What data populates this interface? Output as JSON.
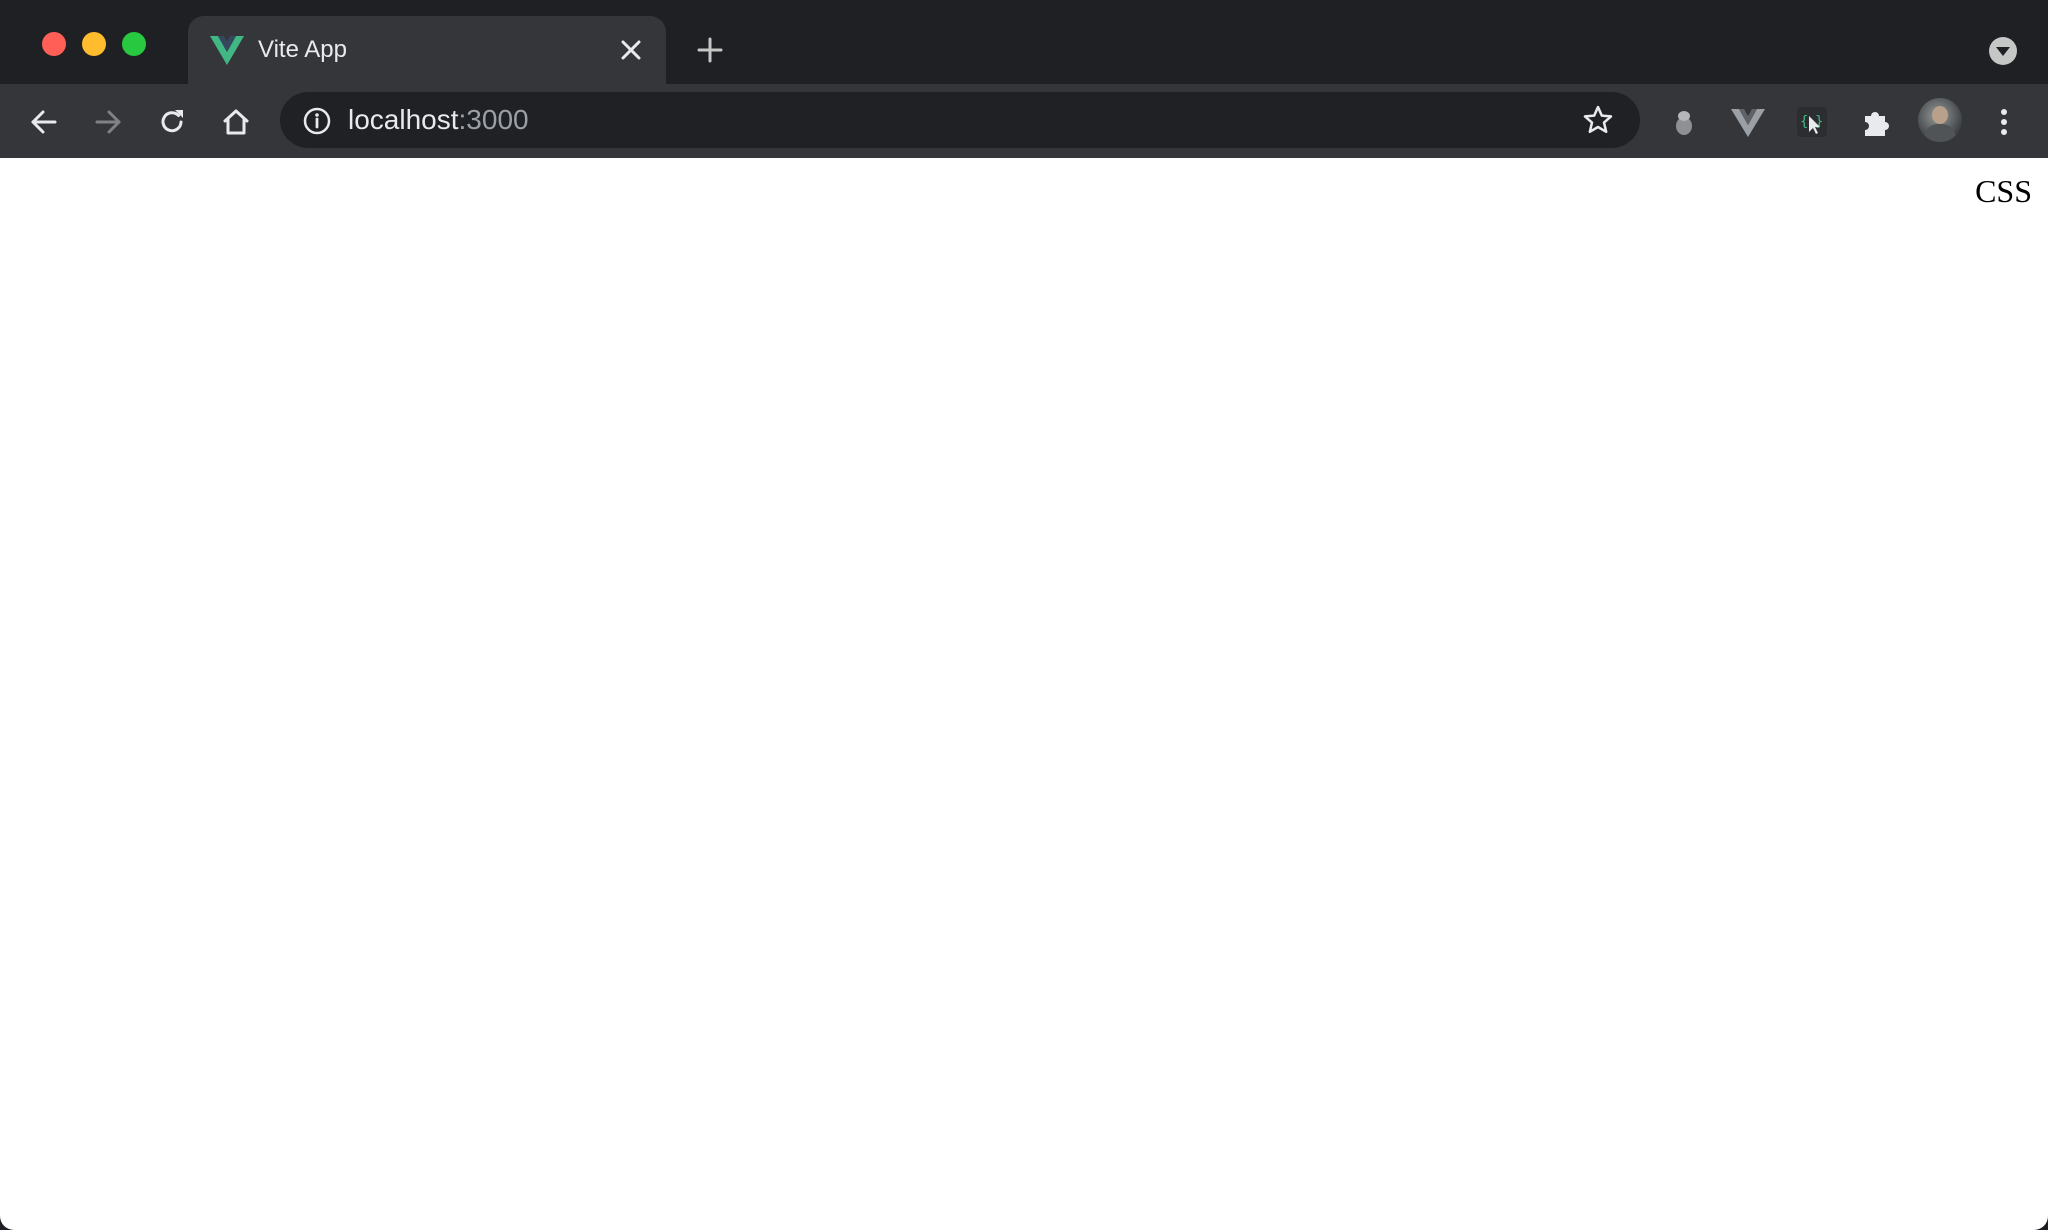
{
  "window": {
    "traffic_colors": {
      "close": "#ff5f57",
      "minimize": "#febc2e",
      "zoom": "#28c840"
    }
  },
  "tabs": [
    {
      "title": "Vite App",
      "favicon": "vue-logo-icon",
      "active": true
    }
  ],
  "omnibox": {
    "host": "localhost",
    "port": ":3000",
    "security_icon": "info-icon"
  },
  "toolbar": {
    "icons": [
      "back-arrow-icon",
      "forward-arrow-icon",
      "reload-icon",
      "home-icon",
      "bookmark-star-icon"
    ],
    "extensions": [
      "gray-extension-icon",
      "vue-devtools-icon",
      "css-picker-icon",
      "puzzle-icon"
    ],
    "menu_icon": "kebab-menu-icon"
  },
  "page": {
    "text": "CSS"
  },
  "colors": {
    "accent_vue_green": "#41b883",
    "vue_dark": "#34495e",
    "tab_bg": "#35363a",
    "strip_bg": "#1f2023",
    "omnibox_bg": "#202124"
  }
}
